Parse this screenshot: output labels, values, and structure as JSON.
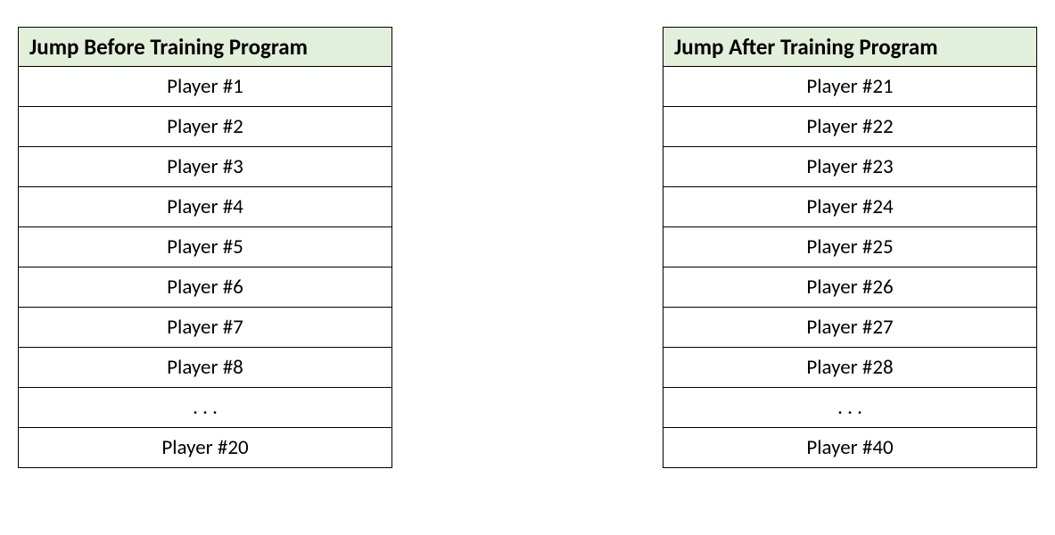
{
  "tables": [
    {
      "header": "Jump Before Training Program",
      "rows": [
        "Player #1",
        "Player #2",
        "Player #3",
        "Player #4",
        "Player #5",
        "Player #6",
        "Player #7",
        "Player #8",
        ". . .",
        "Player #20"
      ]
    },
    {
      "header": "Jump After Training Program",
      "rows": [
        "Player #21",
        "Player #22",
        "Player #23",
        "Player #24",
        "Player #25",
        "Player #26",
        "Player #27",
        "Player #28",
        ". . .",
        "Player #40"
      ]
    }
  ]
}
